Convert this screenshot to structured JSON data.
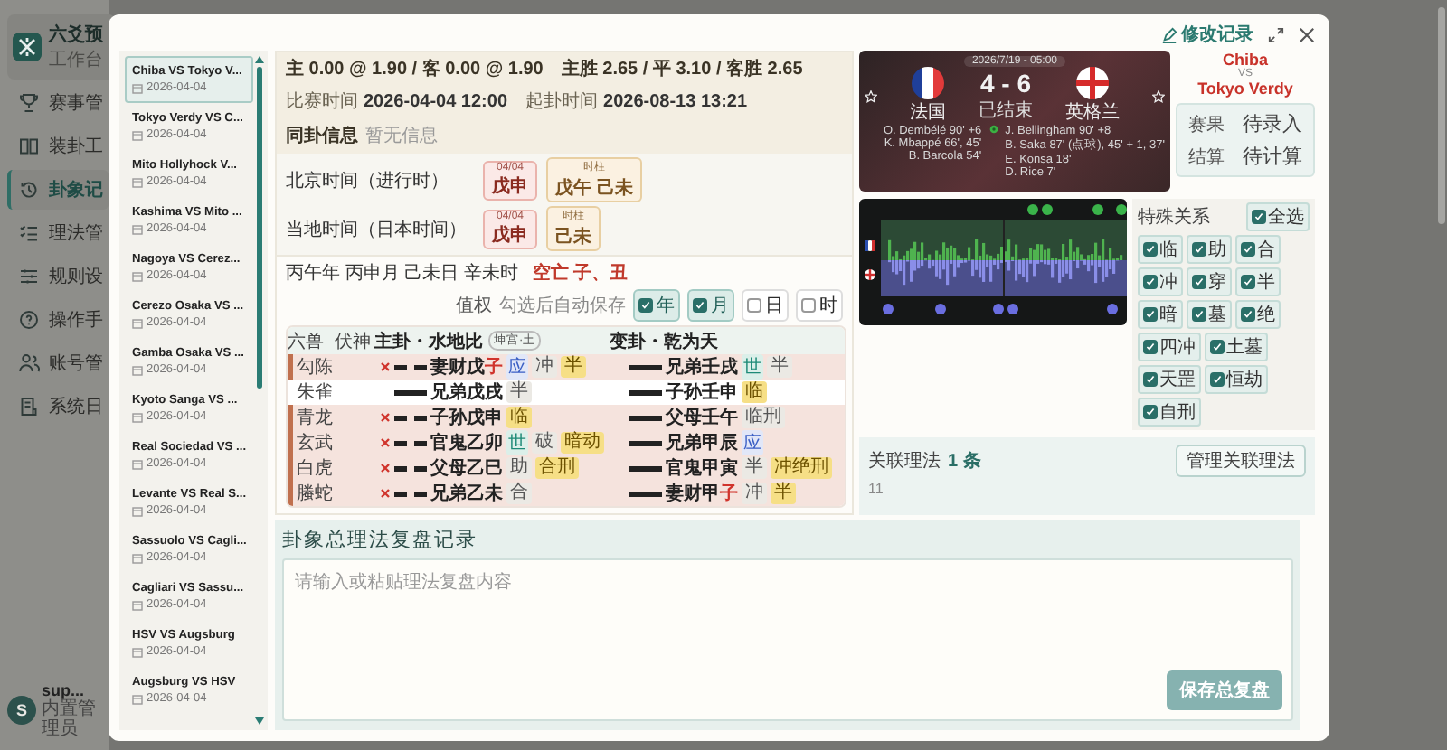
{
  "app_sidebar": {
    "brand": "六爻预",
    "subtitle": "工作台",
    "items": [
      {
        "label": "赛事管",
        "selected": false
      },
      {
        "label": "装卦工",
        "selected": false
      },
      {
        "label": "卦象记",
        "selected": true
      },
      {
        "label": "理法管",
        "selected": false
      },
      {
        "label": "规则设",
        "selected": false
      },
      {
        "label": "操作手",
        "selected": false
      },
      {
        "label": "账号管",
        "selected": false
      },
      {
        "label": "系统日",
        "selected": false
      }
    ],
    "user": {
      "avatar": "S",
      "name": "sup...",
      "role": "内置管理员"
    }
  },
  "modal": {
    "edit_link": "修改记录"
  },
  "records": [
    {
      "title": "Chiba VS Tokyo V...",
      "date": "2026-04-04",
      "selected": true
    },
    {
      "title": "Tokyo Verdy VS C...",
      "date": "2026-04-04",
      "selected": false
    },
    {
      "title": "Mito Hollyhock V...",
      "date": "2026-04-04",
      "selected": false
    },
    {
      "title": "Kashima VS Mito ...",
      "date": "2026-04-04",
      "selected": false
    },
    {
      "title": "Nagoya VS Cerez...",
      "date": "2026-04-04",
      "selected": false
    },
    {
      "title": "Cerezo Osaka VS ...",
      "date": "2026-04-04",
      "selected": false
    },
    {
      "title": "Gamba Osaka VS ...",
      "date": "2026-04-04",
      "selected": false
    },
    {
      "title": "Kyoto Sanga VS ...",
      "date": "2026-04-04",
      "selected": false
    },
    {
      "title": "Real Sociedad VS ...",
      "date": "2026-04-04",
      "selected": false
    },
    {
      "title": "Levante VS Real S...",
      "date": "2026-04-04",
      "selected": false
    },
    {
      "title": "Sassuolo VS Cagli...",
      "date": "2026-04-04",
      "selected": false
    },
    {
      "title": "Cagliari VS Sassu...",
      "date": "2026-04-04",
      "selected": false
    },
    {
      "title": "HSV VS Augsburg",
      "date": "2026-04-04",
      "selected": false
    },
    {
      "title": "Augsburg VS HSV",
      "date": "2026-04-04",
      "selected": false
    }
  ],
  "match_info": {
    "handicap": "主 0.00 @ 1.90 / 客 0.00 @ 1.90",
    "odds": "主胜 2.65 / 平 3.10 / 客胜 2.65",
    "fields": [
      {
        "label": "比赛时间",
        "value": "2026-04-04 12:00"
      },
      {
        "label": "起卦时间",
        "value": "2026-08-13 13:21"
      }
    ],
    "same_hexagram": {
      "label": "同卦信息",
      "value": "暂无信息"
    }
  },
  "time_rows": [
    {
      "label": "北京时间（进行时）",
      "pillars": [
        {
          "caption": "04/04",
          "value": "戊申",
          "kind": "day"
        },
        {
          "caption": "时柱",
          "value": "戊午 己未",
          "kind": "hour"
        }
      ]
    },
    {
      "label": "当地时间（日本时间）",
      "pillars": [
        {
          "caption": "04/04",
          "value": "戊申",
          "kind": "day"
        },
        {
          "caption": "时柱",
          "value": "己未",
          "kind": "hour"
        }
      ]
    }
  ],
  "ganzhi": {
    "text": "丙午年 丙申月 己未日 辛未时",
    "void": "空亡 子、丑",
    "weight_label": "值权",
    "hint": "勾选后自动保存",
    "checks": [
      {
        "label": "年",
        "checked": true
      },
      {
        "label": "月",
        "checked": true
      },
      {
        "label": "日",
        "checked": false
      },
      {
        "label": "时",
        "checked": false
      }
    ]
  },
  "hexagram": {
    "header": {
      "beast": "六兽",
      "hidden": "伏神",
      "main": "主卦・水地比",
      "palace": "坤宫·土",
      "changed": "变卦・乾为天"
    },
    "rows": [
      {
        "beast": "勾陈",
        "moving": true,
        "main": {
          "kind": "yin",
          "label": "妻财戊",
          "branch": "子",
          "void": true,
          "marker": {
            "text": "应",
            "kind": "ying"
          },
          "tags": [
            {
              "text": "冲",
              "kind": "plain"
            },
            {
              "text": "半",
              "kind": "gold"
            }
          ]
        },
        "changed": {
          "kind": "yang",
          "label": "兄弟壬",
          "branch": "戌",
          "void": false,
          "marker": {
            "text": "世",
            "kind": "shi"
          },
          "tags": [
            {
              "text": "半",
              "kind": "plain"
            }
          ]
        }
      },
      {
        "beast": "朱雀",
        "moving": false,
        "main": {
          "kind": "yang",
          "label": "兄弟戊",
          "branch": "戌",
          "void": false,
          "tags": [
            {
              "text": "半",
              "kind": "plain"
            }
          ]
        },
        "changed": {
          "kind": "yang",
          "label": "子孙壬",
          "branch": "申",
          "void": false,
          "tags": [
            {
              "text": "临",
              "kind": "gold"
            }
          ]
        }
      },
      {
        "beast": "青龙",
        "moving": true,
        "main": {
          "kind": "yin",
          "label": "子孙戊",
          "branch": "申",
          "void": false,
          "tags": [
            {
              "text": "临",
              "kind": "gold"
            }
          ]
        },
        "changed": {
          "kind": "yang",
          "label": "父母壬",
          "branch": "午",
          "void": false,
          "tags": [
            {
              "text": "临刑",
              "kind": "plain"
            }
          ]
        }
      },
      {
        "beast": "玄武",
        "moving": true,
        "main": {
          "kind": "yin",
          "label": "官鬼乙",
          "branch": "卯",
          "void": false,
          "marker": {
            "text": "世",
            "kind": "shi"
          },
          "tags": [
            {
              "text": "破",
              "kind": "plain"
            },
            {
              "text": "暗动",
              "kind": "gold"
            }
          ]
        },
        "changed": {
          "kind": "yang",
          "label": "兄弟甲",
          "branch": "辰",
          "void": false,
          "marker": {
            "text": "应",
            "kind": "ying"
          }
        }
      },
      {
        "beast": "白虎",
        "moving": true,
        "main": {
          "kind": "yin",
          "label": "父母乙",
          "branch": "巳",
          "void": false,
          "tags": [
            {
              "text": "助",
              "kind": "plain"
            },
            {
              "text": "合刑",
              "kind": "gold"
            }
          ]
        },
        "changed": {
          "kind": "yang",
          "label": "官鬼甲",
          "branch": "寅",
          "void": false,
          "tags": [
            {
              "text": "半",
              "kind": "plain"
            },
            {
              "text": "冲绝刑",
              "kind": "gold"
            }
          ]
        }
      },
      {
        "beast": "螣蛇",
        "moving": true,
        "main": {
          "kind": "yin",
          "label": "兄弟乙",
          "branch": "未",
          "void": false,
          "tags": [
            {
              "text": "合",
              "kind": "plain"
            }
          ]
        },
        "changed": {
          "kind": "yang",
          "label": "妻财甲",
          "branch": "子",
          "void": true,
          "tags": [
            {
              "text": "冲",
              "kind": "plain"
            },
            {
              "text": "半",
              "kind": "gold"
            }
          ]
        }
      }
    ]
  },
  "match_card": {
    "date": "2026/7/19 - 05:00",
    "score": "4 - 6",
    "status": "已结束",
    "home": {
      "name": "法国",
      "scorers": [
        "O. Dembélé 90' +6",
        "K. Mbappé 66', 45'",
        "B. Barcola 54'"
      ]
    },
    "away": {
      "name": "英格兰",
      "scorers": [
        "J. Bellingham 90' +8",
        "B. Saka 87' (点球), 45' + 1, 37'",
        "E. Konsa 18'",
        "D. Rice 7'"
      ]
    }
  },
  "versus": {
    "home": "Chiba",
    "vs": "VS",
    "away": "Tokyo Verdy"
  },
  "result": [
    {
      "label": "赛果",
      "value": "待录入"
    },
    {
      "label": "结算",
      "value": "待计算"
    }
  ],
  "special_relations": {
    "title": "特殊关系",
    "select_all": {
      "label": "全选",
      "checked": true
    },
    "items": [
      {
        "label": "临",
        "checked": true
      },
      {
        "label": "助",
        "checked": true
      },
      {
        "label": "合",
        "checked": true
      },
      {
        "label": "冲",
        "checked": true
      },
      {
        "label": "穿",
        "checked": true
      },
      {
        "label": "半",
        "checked": true
      },
      {
        "label": "暗",
        "checked": true
      },
      {
        "label": "墓",
        "checked": true
      },
      {
        "label": "绝",
        "checked": true
      },
      {
        "label": "四冲",
        "checked": true
      },
      {
        "label": "土墓",
        "checked": true
      },
      {
        "label": "天罡",
        "checked": true
      },
      {
        "label": "恒劫",
        "checked": true
      },
      {
        "label": "自刑",
        "checked": true
      }
    ]
  },
  "linked_laws": {
    "title": "关联理法",
    "count": "1 条",
    "items": [
      "11"
    ],
    "button": "管理关联理法"
  },
  "review": {
    "title": "卦象总理法复盘记录",
    "placeholder": "请输入或粘贴理法复盘内容",
    "button": "保存总复盘"
  }
}
